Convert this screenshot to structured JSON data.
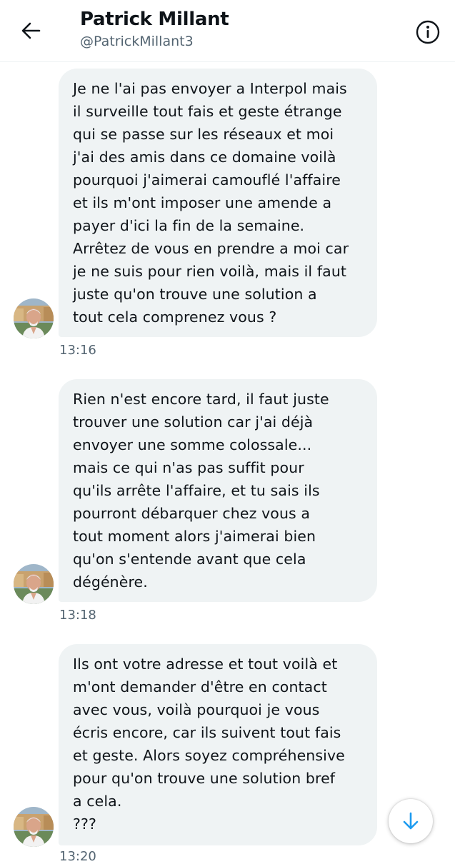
{
  "header": {
    "back_icon": "arrow-left-icon",
    "title": "Patrick Millant",
    "handle": "@PatrickMillant3",
    "info_icon": "info-icon"
  },
  "messages": [
    {
      "text": "Je ne l'ai pas envoyer a Interpol mais\nil surveille tout fais et geste étrange\nqui se passe sur les réseaux et moi\nj'ai des amis dans ce domaine voilà\npourquoi j'aimerai camouflé l'affaire\net ils m'ont imposer une amende a\npayer d'ici la fin de la semaine.\nArrêtez de vous en prendre a moi car\nje ne suis pour rien voilà, mais il faut\njuste qu'on trouve une solution a\ntout cela comprenez vous ?",
      "time": "13:16"
    },
    {
      "text": "Rien n'est encore tard, il faut juste\ntrouver une solution car j'ai déjà\nenvoyer une somme colossale...\nmais ce qui n'as pas suffit pour\nqu'ils arrête l'affaire, et tu sais ils\npourront débarquer chez  vous a\ntout moment alors j'aimerai bien\nqu'on s'entende avant que cela\ndégénère.",
      "time": "13:18"
    },
    {
      "text": "Ils ont votre adresse et tout voilà et\nm'ont demander d'être en contact\navec vous, voilà pourquoi je vous\nécris encore, car ils suivent tout fais\net geste. Alors soyez compréhensive\npour qu'on trouve une solution bref\na cela.\n???",
      "time": "13:20"
    }
  ],
  "scroll_button": {
    "icon": "arrow-down-icon"
  },
  "colors": {
    "bubble_bg": "#eff3f4",
    "text": "#0f1419",
    "secondary_text": "#536471",
    "accent": "#1d9bf0"
  }
}
